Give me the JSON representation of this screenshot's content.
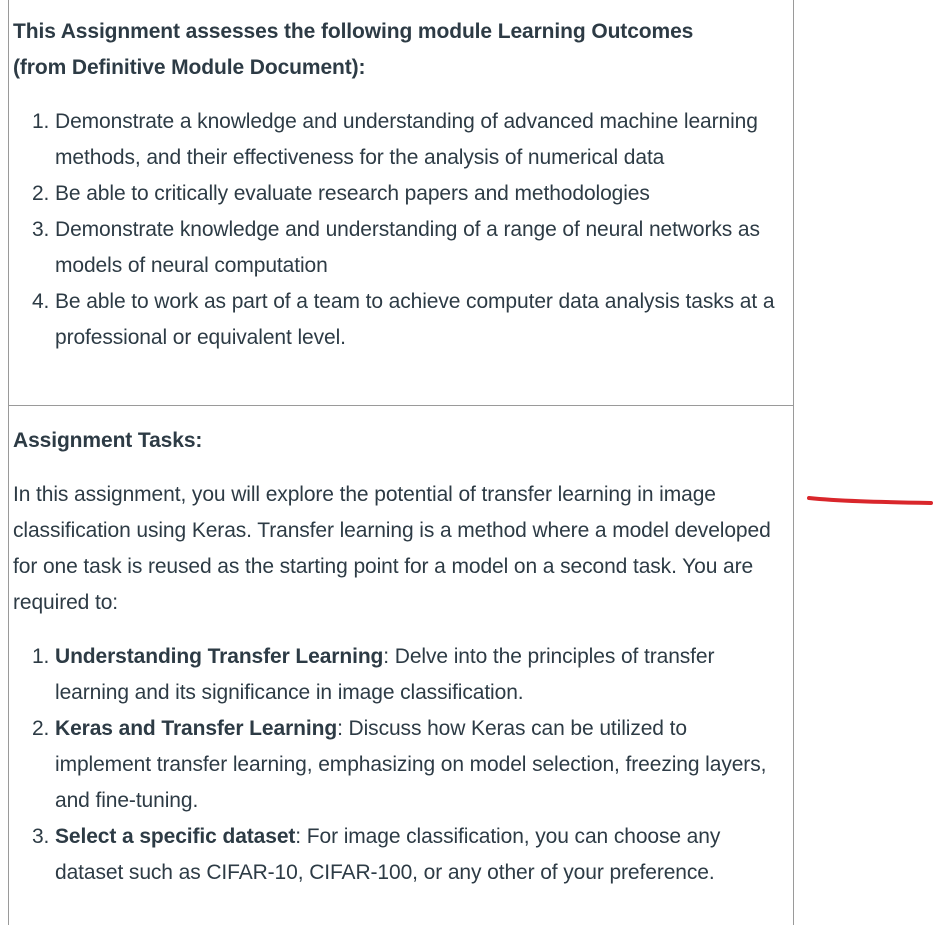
{
  "outcomes_section": {
    "heading_line1": "This Assignment assesses the following module Learning Outcomes",
    "heading_line2": "(from Definitive Module Document):",
    "items": [
      {
        "text": "Demonstrate a knowledge and understanding of advanced machine learning methods, and their effectiveness for the analysis of numerical data"
      },
      {
        "text": "Be able to critically evaluate research papers and methodologies"
      },
      {
        "text": "Demonstrate knowledge and understanding of a range of neural networks as models of neural computation"
      },
      {
        "text": "Be able to work as part of a team to achieve computer data analysis tasks at a professional or equivalent level."
      }
    ]
  },
  "tasks_section": {
    "heading": "Assignment Tasks:",
    "intro": "In this assignment, you will explore the potential of transfer learning in image classification using Keras. Transfer learning is a method where a model developed for one task is reused as the starting point for a model on a second task. You are required to:",
    "items": [
      {
        "title": "Understanding Transfer Learning",
        "text": ": Delve into the principles of transfer learning and its significance in image classification."
      },
      {
        "title": "Keras and Transfer Learning",
        "text": ": Discuss how Keras can be utilized to implement transfer learning, emphasizing on model selection, freezing layers, and fine-tuning."
      },
      {
        "title": "Select a specific dataset",
        "text": ": For image classification, you can choose any dataset such as CIFAR-10, CIFAR-100, or any other of your preference."
      }
    ]
  },
  "annotation": {
    "color": "#d9262b"
  }
}
